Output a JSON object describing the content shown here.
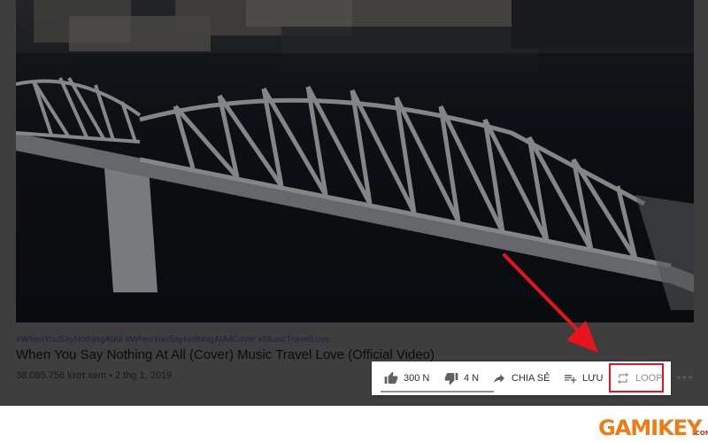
{
  "video": {
    "hashtags": "#WhenYouSayNothingAtAll #WhenYouSayNothingAtAllCover #MusicTravelLove",
    "title": "When You Say Nothing At All (Cover) Music Travel Love (Official Video)",
    "views_date": "38.085.756 lượt xem • 2 thg 1, 2019"
  },
  "toolbar": {
    "like_count": "300 N",
    "dislike_count": "4 N",
    "share_label": "CHIA SẺ",
    "save_label": "LƯU",
    "loop_label": "LOOP",
    "more_label": "•••"
  },
  "colors": {
    "highlight": "#e8141c",
    "arrow": "#e8141c",
    "brand": "#f07a14"
  },
  "watermark": {
    "text": "GAMIKEY",
    "suffix": ".COM"
  }
}
